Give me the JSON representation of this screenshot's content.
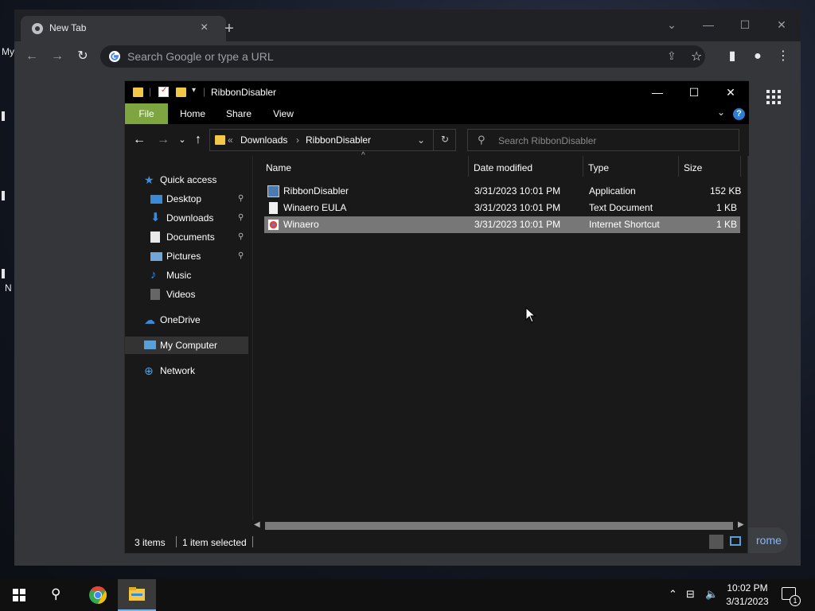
{
  "desktop": {
    "fragments": [
      "My",
      "I",
      "I",
      "I",
      "N"
    ]
  },
  "chrome": {
    "tab_title": "New Tab",
    "omnibox_placeholder": "Search Google or type a URL",
    "customize_label": "rome"
  },
  "explorer": {
    "title": "RibbonDisabler",
    "ribbon_tabs": [
      "File",
      "Home",
      "Share",
      "View"
    ],
    "breadcrumb": [
      "Downloads",
      "RibbonDisabler"
    ],
    "breadcrumb_prefix": "«",
    "search_placeholder": "Search RibbonDisabler",
    "nav_pane": [
      {
        "label": "Quick access",
        "icon": "star-icon"
      },
      {
        "label": "Desktop",
        "icon": "desktop-icon",
        "pinned": true
      },
      {
        "label": "Downloads",
        "icon": "download-icon",
        "pinned": true
      },
      {
        "label": "Documents",
        "icon": "documents-icon",
        "pinned": true
      },
      {
        "label": "Pictures",
        "icon": "pictures-icon",
        "pinned": true
      },
      {
        "label": "Music",
        "icon": "music-icon"
      },
      {
        "label": "Videos",
        "icon": "videos-icon"
      },
      {
        "label": "OneDrive",
        "icon": "cloud-icon"
      },
      {
        "label": "My Computer",
        "icon": "computer-icon",
        "selected": true
      },
      {
        "label": "Network",
        "icon": "network-icon"
      }
    ],
    "columns": [
      "Name",
      "Date modified",
      "Type",
      "Size"
    ],
    "files": [
      {
        "name": "RibbonDisabler",
        "date": "3/31/2023 10:01 PM",
        "type": "Application",
        "size": "152 KB",
        "icon": "application-icon"
      },
      {
        "name": "Winaero EULA",
        "date": "3/31/2023 10:01 PM",
        "type": "Text Document",
        "size": "1 KB",
        "icon": "text-document-icon"
      },
      {
        "name": "Winaero",
        "date": "3/31/2023 10:01 PM",
        "type": "Internet Shortcut",
        "size": "1 KB",
        "icon": "internet-shortcut-icon",
        "selected": true
      }
    ],
    "status": {
      "item_count": "3 items",
      "selected": "1 item selected"
    }
  },
  "taskbar": {
    "time": "10:02 PM",
    "date": "3/31/2023",
    "notification_count": "1"
  },
  "colors": {
    "file_tab": "#7da640",
    "selected_row": "#777777",
    "folder": "#f3c846"
  }
}
